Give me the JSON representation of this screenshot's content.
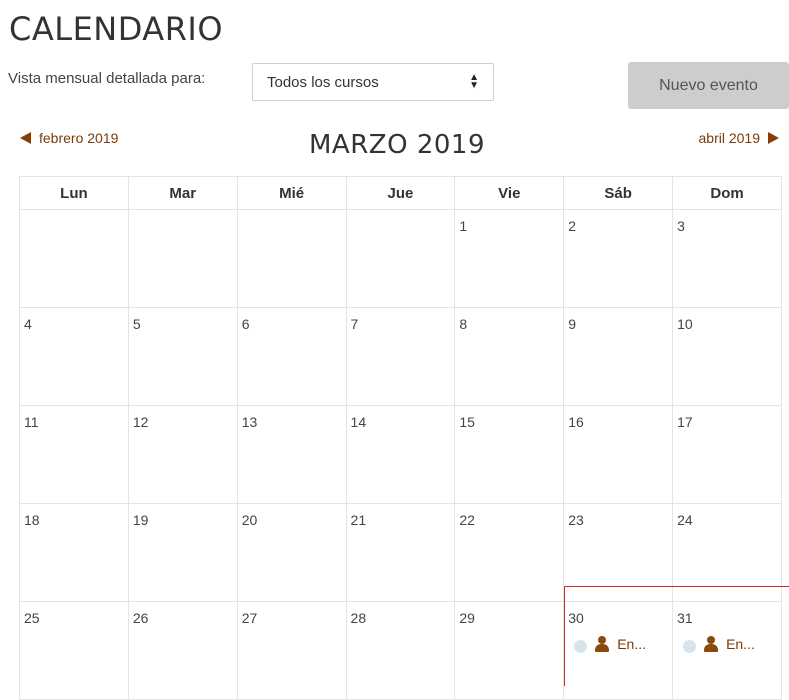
{
  "page": {
    "title": "CALENDARIO"
  },
  "filter": {
    "label": "Vista mensual detallada para:",
    "selected": "Todos los cursos"
  },
  "toolbar": {
    "new_event_label": "Nuevo evento"
  },
  "nav": {
    "prev_label": "febrero 2019",
    "next_label": "abril 2019",
    "month_title": "MARZO 2019"
  },
  "weekdays": [
    "Lun",
    "Mar",
    "Mié",
    "Jue",
    "Vie",
    "Sáb",
    "Dom"
  ],
  "weeks": [
    [
      "",
      "",
      "",
      "",
      "1",
      "2",
      "3"
    ],
    [
      "4",
      "5",
      "6",
      "7",
      "8",
      "9",
      "10"
    ],
    [
      "11",
      "12",
      "13",
      "14",
      "15",
      "16",
      "17"
    ],
    [
      "18",
      "19",
      "20",
      "21",
      "22",
      "23",
      "24"
    ],
    [
      "25",
      "26",
      "27",
      "28",
      "29",
      "30",
      "31"
    ]
  ],
  "events": {
    "day30": {
      "label": "En...",
      "icon": "user-icon"
    },
    "day31": {
      "label": "En...",
      "icon": "user-icon"
    }
  },
  "colors": {
    "accent": "#8b3d06",
    "button_bg": "#cdcdcd",
    "highlight": "#cc2b2b"
  }
}
